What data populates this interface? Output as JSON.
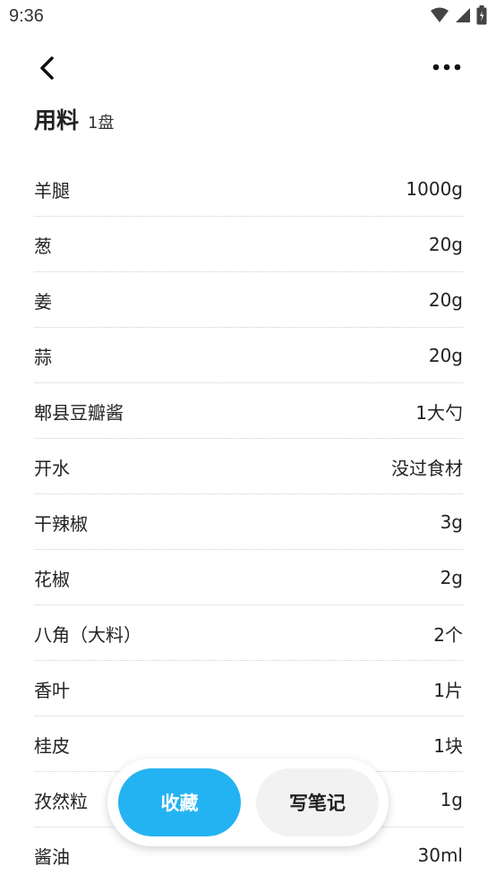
{
  "status": {
    "time": "9:36",
    "icons": [
      "wifi-icon",
      "signal-icon",
      "battery-icon"
    ]
  },
  "nav": {
    "back_icon": "chevron-left-icon",
    "more_icon": "more-dots-icon"
  },
  "header": {
    "title": "用料",
    "servings": "1盘"
  },
  "ingredients": [
    {
      "name": "羊腿",
      "amount": "1000g"
    },
    {
      "name": "葱",
      "amount": "20g"
    },
    {
      "name": "姜",
      "amount": "20g"
    },
    {
      "name": "蒜",
      "amount": "20g"
    },
    {
      "name": "郫县豆瓣酱",
      "amount": "1大勺"
    },
    {
      "name": "开水",
      "amount": "没过食材"
    },
    {
      "name": "干辣椒",
      "amount": "3g"
    },
    {
      "name": "花椒",
      "amount": "2g"
    },
    {
      "name": "八角（大料）",
      "amount": "2个"
    },
    {
      "name": "香叶",
      "amount": "1片"
    },
    {
      "name": "桂皮",
      "amount": "1块"
    },
    {
      "name": "孜然粒",
      "amount": "1g"
    },
    {
      "name": "酱油",
      "amount": "30ml"
    }
  ],
  "actions": {
    "collect_label": "收藏",
    "note_label": "写笔记"
  },
  "colors": {
    "accent": "#24b3f2",
    "secondary_button": "#f2f2f2"
  }
}
